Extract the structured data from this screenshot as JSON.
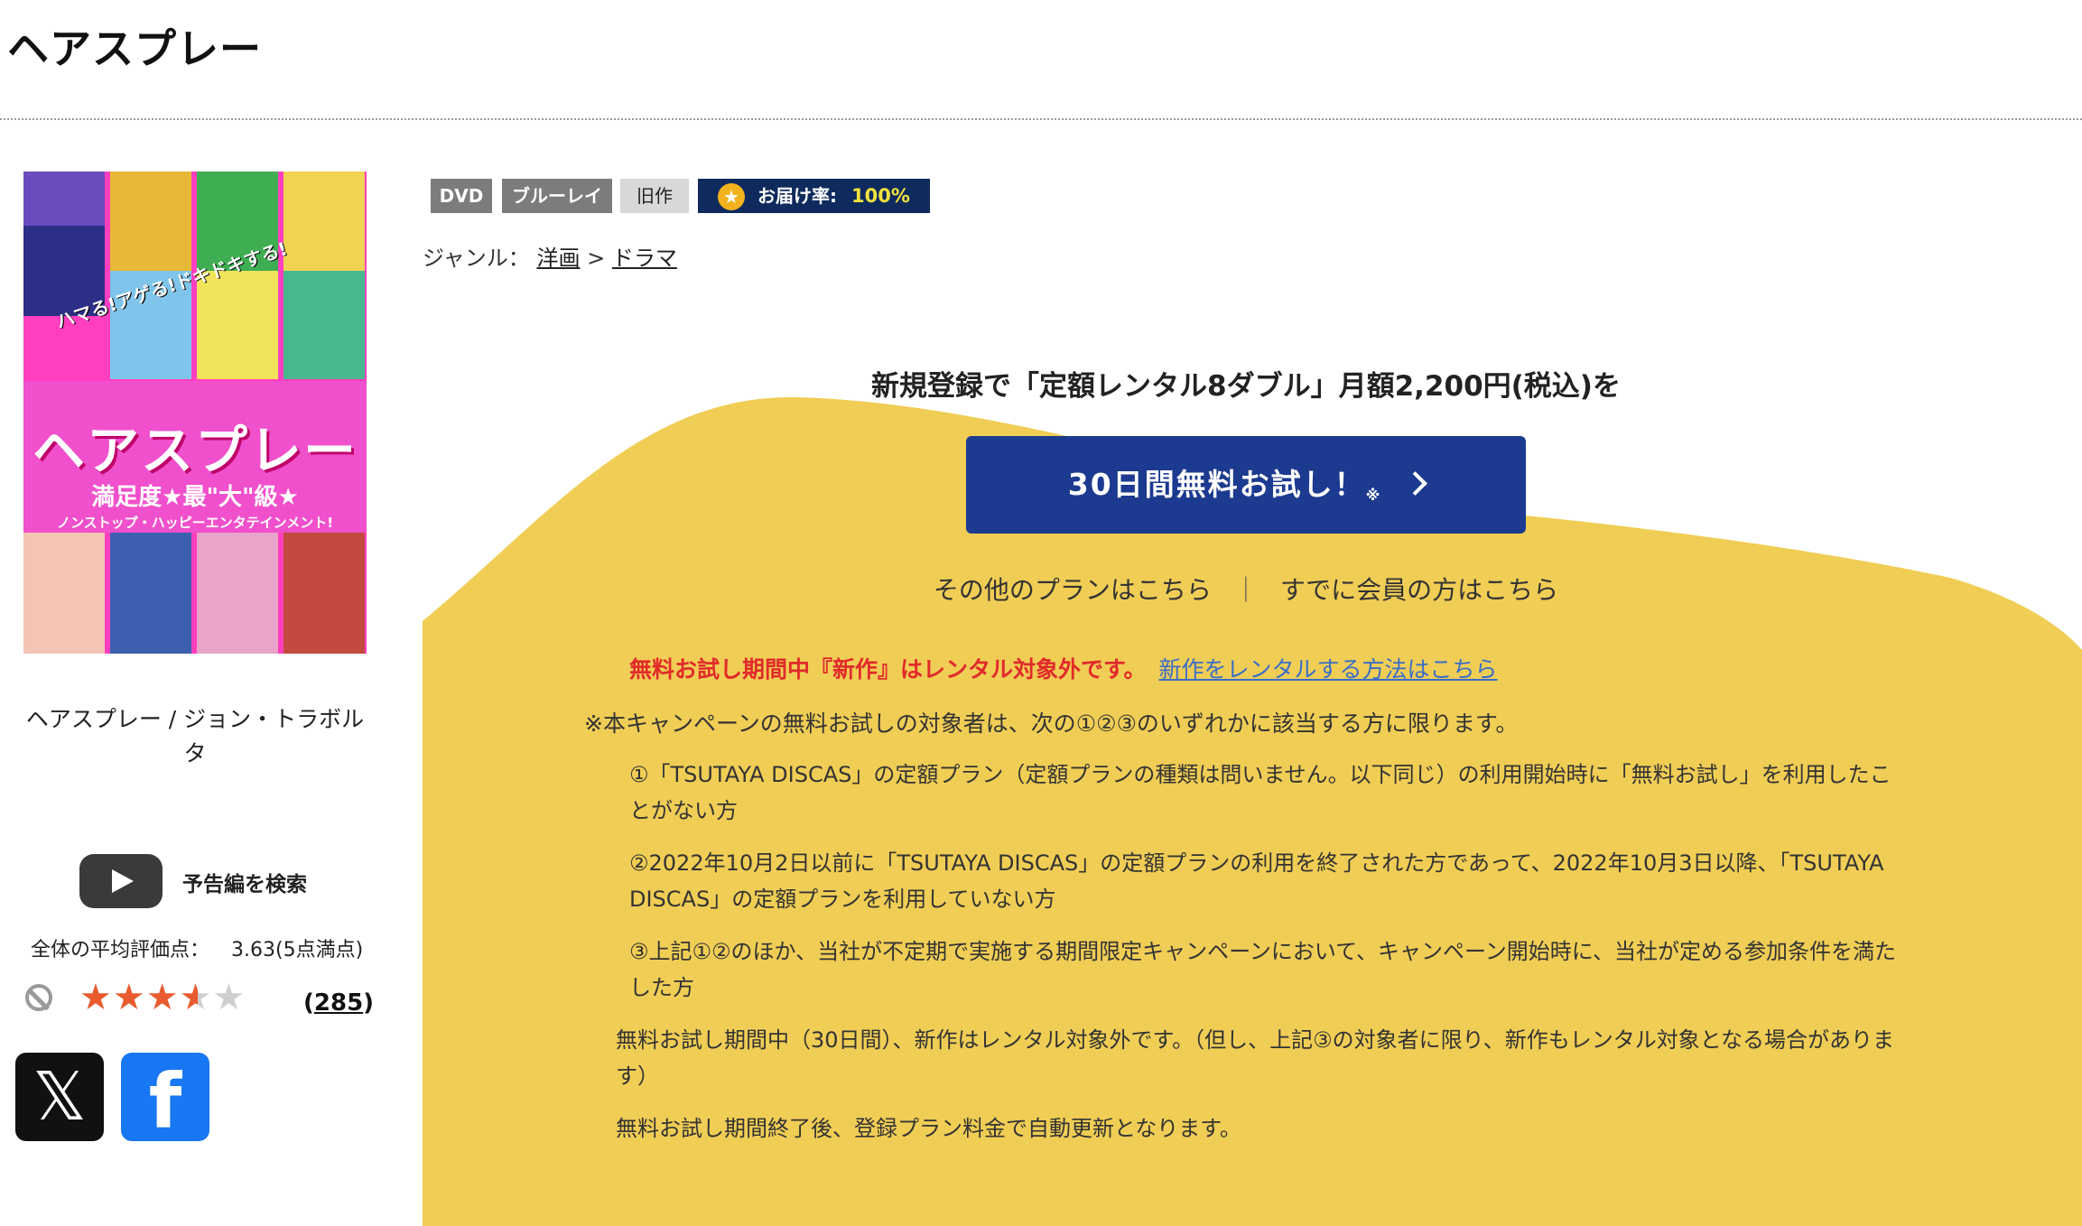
{
  "page": {
    "title": "ヘアスプレー"
  },
  "poster": {
    "title": "ヘアスプレー",
    "subtitle": "満足度★最\"大\"級★",
    "tagline": "ノンストップ・ハッピーエンタテインメント!",
    "catch": "ハマる!アゲる!ドキドキする!"
  },
  "work": {
    "title": "ヘアスプレー / ジョン・トラボルタ"
  },
  "trailer": {
    "label": "予告編を検索",
    "icon": "youtube-play-icon"
  },
  "rating": {
    "average_label": "全体の平均評価点：",
    "average_value": "3.63(5点満点)",
    "score": 3.63,
    "max": 5,
    "review_count": "285",
    "count_open": "(",
    "count_close": ")"
  },
  "share": {
    "x_label": "𝕏",
    "facebook_label": "f"
  },
  "badges": {
    "dvd": "DVD",
    "bluray": "ブルーレイ",
    "old": "旧作",
    "delivery_label": "お届け率:",
    "delivery_value": "100%"
  },
  "genre": {
    "label": "ジャンル：",
    "items": [
      "洋画",
      "ドラマ"
    ],
    "sep": ">"
  },
  "campaign": {
    "heading": "新規登録で「定額レンタル8ダブル」月額2,200円(税込)を",
    "button_label": "30日間無料お試し！",
    "button_mark": "※",
    "other_plans": "その他のプランはこちら",
    "separator": "｜",
    "member_link": "すでに会員の方はこちら",
    "warning": "無料お試し期間中『新作』はレンタル対象外です。",
    "warning_link": "新作をレンタルする方法はこちら",
    "notice": "※本キャンペーンの無料お試しの対象者は、次の①②③のいずれかに該当する方に限ります。",
    "conditions": [
      "①「TSUTAYA DISCAS」の定額プラン（定額プランの種類は問いません。以下同じ）の利用開始時に「無料お試し」を利用したことがない方",
      "②2022年10月2日以前に「TSUTAYA DISCAS」の定額プランの利用を終了された方であって、2022年10月3日以降、「TSUTAYA DISCAS」の定額プランを利用していない方",
      "③上記①②のほか、当社が不定期で実施する期間限定キャンペーンにおいて、キャンペーン開始時に、当社が定める参加条件を満たした方"
    ],
    "free_note": "無料お試し期間中（30日間）、新作はレンタル対象外です。（但し、上記③の対象者に限り、新作もレンタル対象となる場合があります）",
    "renew_note": "無料お試し期間終了後、登録プラン料金で自動更新となります。"
  },
  "colors": {
    "campaign_bg": "#f0cd55",
    "button": "#1c3a8f",
    "warning": "#e02b2b",
    "link": "#3a6ec8",
    "delivery_badge": "#0f2a5c",
    "star": "#e85b2e"
  }
}
